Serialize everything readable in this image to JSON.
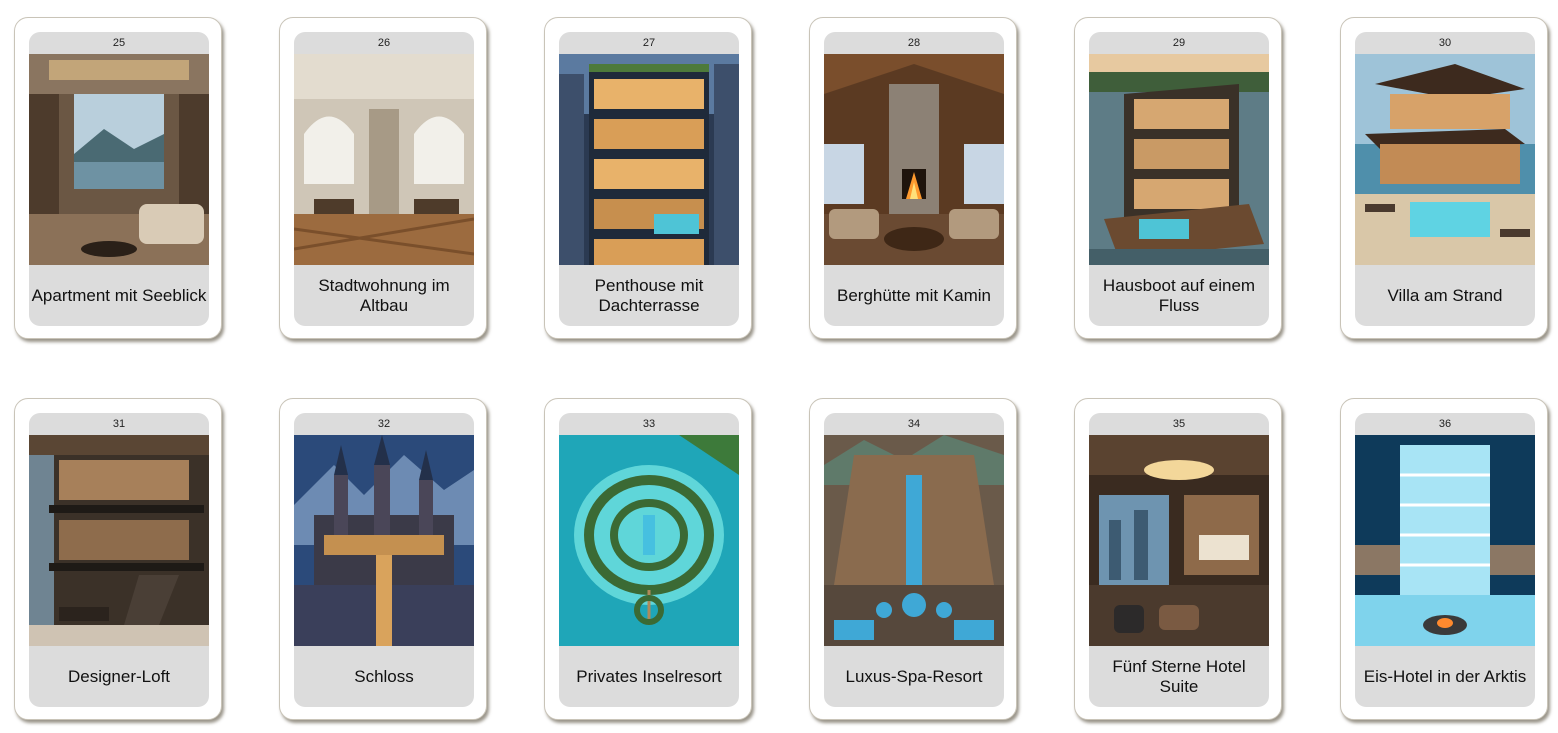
{
  "cards": [
    {
      "number": "25",
      "title": "Apartment mit Seeblick",
      "image": "modern-apartment-lake-view"
    },
    {
      "number": "26",
      "title": "Stadtwohnung im Altbau",
      "image": "classic-old-building-apartment"
    },
    {
      "number": "27",
      "title": "Penthouse mit Dachterrasse",
      "image": "penthouse-roof-terrace"
    },
    {
      "number": "28",
      "title": "Berghütte mit Kamin",
      "image": "mountain-lodge-fireplace"
    },
    {
      "number": "29",
      "title": "Hausboot auf einem Fluss",
      "image": "houseboat-river"
    },
    {
      "number": "30",
      "title": "Villa am Strand",
      "image": "beach-villa"
    },
    {
      "number": "31",
      "title": "Designer-Loft",
      "image": "designer-loft"
    },
    {
      "number": "32",
      "title": "Schloss",
      "image": "castle"
    },
    {
      "number": "33",
      "title": "Privates Inselresort",
      "image": "private-island-resort"
    },
    {
      "number": "34",
      "title": "Luxus-Spa-Resort",
      "image": "luxury-spa-resort"
    },
    {
      "number": "35",
      "title": "Fünf Sterne Hotel Suite",
      "image": "five-star-hotel-suite"
    },
    {
      "number": "36",
      "title": "Eis-Hotel in der Arktis",
      "image": "arctic-ice-hotel"
    }
  ]
}
